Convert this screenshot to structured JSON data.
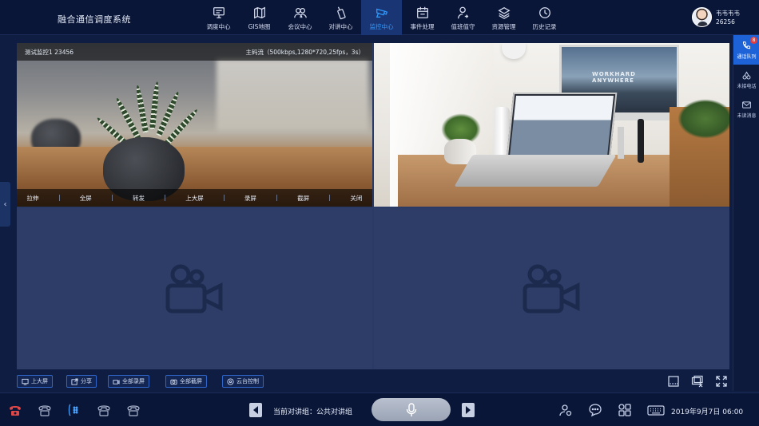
{
  "header": {
    "app_title": "融合通信调度系统",
    "nav": [
      {
        "label": "调度中心",
        "icon": "monitor-icon"
      },
      {
        "label": "GIS地图",
        "icon": "map-icon"
      },
      {
        "label": "会议中心",
        "icon": "meeting-icon"
      },
      {
        "label": "对讲中心",
        "icon": "walkie-talkie-icon"
      },
      {
        "label": "监控中心",
        "icon": "camera-icon",
        "active": true
      },
      {
        "label": "事件处理",
        "icon": "calendar-icon"
      },
      {
        "label": "值班值守",
        "icon": "user-duty-icon"
      },
      {
        "label": "资源管理",
        "icon": "layers-icon"
      },
      {
        "label": "历史记录",
        "icon": "history-icon"
      }
    ],
    "user_name": "韦韦韦韦",
    "user_id": "26256"
  },
  "right_bar": [
    {
      "label": "通话队列",
      "icon": "phone-queue-icon",
      "badge": "8",
      "active": true
    },
    {
      "label": "未接电话",
      "icon": "missed-call-icon"
    },
    {
      "label": "未读消息",
      "icon": "mail-icon"
    }
  ],
  "video": {
    "cell1_name": "测试监控1 23456",
    "cell1_stream": "主码流（500kbps,1280*720,25fps，3s）",
    "cell1_actions": [
      "拉伸",
      "全屏",
      "转发",
      "上大屏",
      "录屏",
      "截屏",
      "关闭"
    ]
  },
  "toolbar": {
    "buttons": [
      "上大屏",
      "分享",
      "全部录屏",
      "全部截屏",
      "云台控制"
    ]
  },
  "footer": {
    "ptt_label": "当前对讲组：公共对讲组",
    "datetime": "2019年9月7日 06:00"
  },
  "colors": {
    "accent": "#2f9bff",
    "active_nav_bg": "#1a3574",
    "active_side_bg": "#1e62d8",
    "badge": "#e53d3d",
    "panel": "#2e3d68"
  }
}
